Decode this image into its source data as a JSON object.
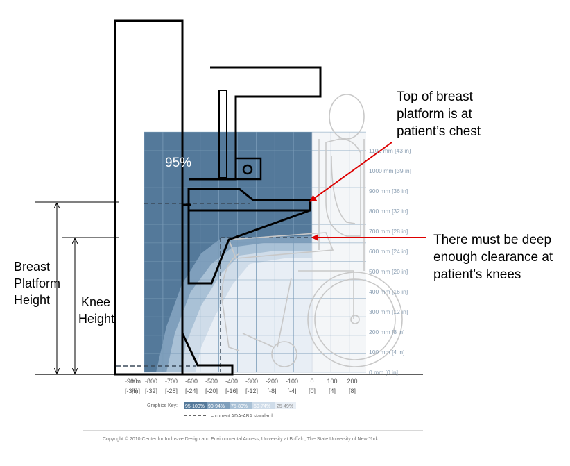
{
  "annotations": {
    "top_platform": "Top of breast platform is at patient’s chest",
    "top_platform_lines": [
      "Top of breast",
      "platform is at",
      "patient’s chest"
    ],
    "clearance": "There must be deep enough clearance at patient’s knees",
    "clearance_lines": [
      "There must be deep",
      "enough clearance at",
      "patient’s knees"
    ],
    "breast_platform_height": [
      "Breast",
      "Platform",
      "Height"
    ],
    "knee_height": [
      "Knee",
      "Height"
    ]
  },
  "grid": {
    "percent_label": "95%",
    "y_ticks": [
      "1100 mm [43 in]",
      "1000 mm [39 in]",
      "900 mm [36 in]",
      "800 mm [32 in]",
      "700 mm [28 in]",
      "600 mm [24 in]",
      "500 mm [20 in]",
      "400 mm [16 in]",
      "300 mm [12 in]",
      "200 mm [8 in]",
      "100 mm [4 in]",
      "0 mm [0 in]"
    ],
    "x_unit_mm": "mm",
    "x_unit_in": "[in]",
    "x_ticks_mm": [
      "-900",
      "-800",
      "-700",
      "-600",
      "-500",
      "-400",
      "-300",
      "-200",
      "-100",
      "0",
      "100",
      "200"
    ],
    "x_ticks_in": [
      "[-34]",
      "[-32]",
      "[-28]",
      "[-24]",
      "[-20]",
      "[-16]",
      "[-12]",
      "[-8]",
      "[-4]",
      "[0]",
      "[4]",
      "[8]"
    ]
  },
  "graphics_key": {
    "label": "Graphics Key:",
    "items": [
      "95-100%",
      "90-94%",
      "75-89%",
      "50-74%",
      "25-49%"
    ],
    "dashed_label": "= current ADA-ABA standard"
  },
  "copyright": "Copyright © 2010 Center for Inclusive Design and Environmental Access, University at Buffalo, The State University of New York",
  "colors": {
    "band_95": "#54799a",
    "band_90": "#7f9fbc",
    "band_75": "#a9c1d6",
    "band_50": "#cfdce9",
    "band_25": "#e8eef5",
    "arrow": "#dd0000",
    "grid_line": "#7a9bb8",
    "figure_line": "#c8c8c8"
  }
}
